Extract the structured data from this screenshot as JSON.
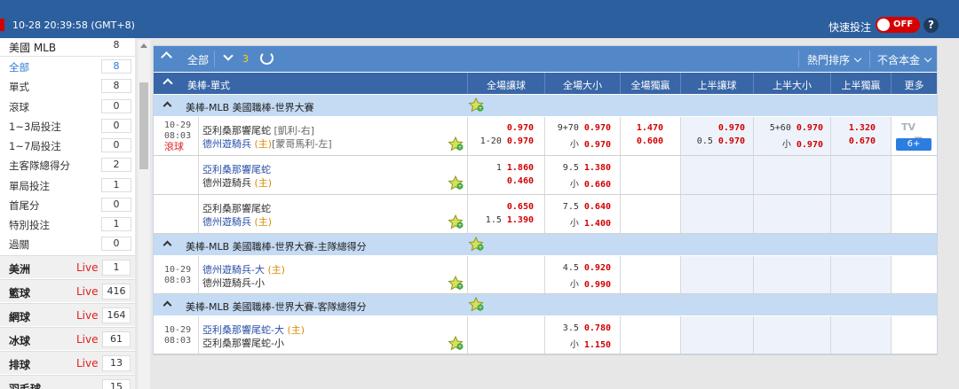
{
  "topbar": {
    "clock": "10-28 20:39:58 (GMT+8)",
    "quick_bet": "快速投注",
    "toggle": "OFF",
    "help": "?"
  },
  "sidebar": {
    "header": {
      "label": "美國 MLB",
      "count": "8"
    },
    "items": [
      {
        "label": "全部",
        "count": "8",
        "active": true
      },
      {
        "label": "單式",
        "count": "8"
      },
      {
        "label": "滾球",
        "count": "0"
      },
      {
        "label": "1~3局投注",
        "count": "0"
      },
      {
        "label": "1~7局投注",
        "count": "0"
      },
      {
        "label": "主客隊總得分",
        "count": "2"
      },
      {
        "label": "單局投注",
        "count": "1"
      },
      {
        "label": "首尾分",
        "count": "0"
      },
      {
        "label": "特別投注",
        "count": "1"
      },
      {
        "label": "過關",
        "count": "0"
      }
    ],
    "sports": [
      {
        "label": "美洲",
        "live": "Live",
        "count": "1"
      },
      {
        "label": "籃球",
        "live": "Live",
        "count": "416"
      },
      {
        "label": "網球",
        "live": "Live",
        "count": "164"
      },
      {
        "label": "冰球",
        "live": "Live",
        "count": "61"
      },
      {
        "label": "排球",
        "live": "Live",
        "count": "13"
      },
      {
        "label": "羽毛球",
        "live": "",
        "count": "15"
      }
    ]
  },
  "toolbar": {
    "all": "全部",
    "count": "3",
    "sort": "熱門排序",
    "no_capital": "不含本金"
  },
  "table_header": {
    "title": "美棒-單式",
    "columns": [
      "全場讓球",
      "全場大小",
      "全場獨贏",
      "上半讓球",
      "上半大小",
      "上半獨贏",
      "更多"
    ]
  },
  "leagues": [
    {
      "name": "美棒-MLB 美國職棒-世界大賽",
      "rows": [
        {
          "date": "10-29",
          "time": "08:03",
          "live": "滾球",
          "team1": "亞利桑那響尾蛇",
          "team1_pitcher": "[凱利-右]",
          "team2": "德州遊騎兵",
          "team2_home": "(主)",
          "team2_pitcher": "[蒙哥馬利-左]",
          "hdp": [
            "",
            "0.970",
            "1-20",
            "0.970"
          ],
          "ou": [
            "9+70",
            "0.970",
            "小",
            "0.970"
          ],
          "ml": [
            "1.470",
            "0.600"
          ],
          "h_hdp": [
            "",
            "0.970",
            "0.5",
            "0.970"
          ],
          "h_ou": [
            "5+60",
            "0.970",
            "小",
            "0.970"
          ],
          "h_ml": [
            "1.320",
            "0.670"
          ],
          "tv": "TV",
          "more": "6+"
        },
        {
          "team1": "亞利桑那響尾蛇",
          "team2": "德州遊騎兵",
          "team2_home": "(主)",
          "hdp": [
            "1",
            "1.860",
            "",
            "0.460"
          ],
          "ou": [
            "9.5",
            "1.380",
            "小",
            "0.660"
          ]
        },
        {
          "team1": "亞利桑那響尾蛇",
          "team2": "德州遊騎兵",
          "team2_home": "(主)",
          "hdp": [
            "",
            "0.650",
            "1.5",
            "1.390"
          ],
          "ou": [
            "7.5",
            "0.640",
            "小",
            "1.400"
          ]
        }
      ]
    },
    {
      "name": "美棒-MLB 美國職棒-世界大賽-主隊總得分",
      "rows": [
        {
          "date": "10-29",
          "time": "08:03",
          "team1": "德州遊騎兵-大",
          "team1_home": "(主)",
          "team2": "德州遊騎兵-小",
          "ou": [
            "4.5",
            "0.920",
            "小",
            "0.990"
          ]
        }
      ]
    },
    {
      "name": "美棒-MLB 美國職棒-世界大賽-客隊總得分",
      "rows": [
        {
          "date": "10-29",
          "time": "08:03",
          "team1": "亞利桑那響尾蛇-大",
          "team1_home": "(主)",
          "team2": "亞利桑那響尾蛇-小",
          "ou": [
            "3.5",
            "0.780",
            "小",
            "1.150"
          ]
        }
      ]
    }
  ]
}
